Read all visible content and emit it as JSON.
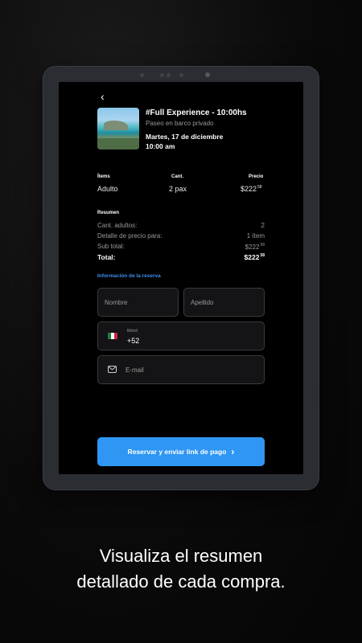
{
  "booking": {
    "title": "#Full Experience - 10:00hs",
    "subtitle": "Paseo en barco privado",
    "date": "Martes, 17 de diciembre",
    "time": "10:00 am"
  },
  "table": {
    "headers": {
      "items": "Ítems",
      "qty": "Cant.",
      "price": "Precio"
    },
    "row": {
      "item": "Adulto",
      "qty": "2 pax",
      "price_main": "$222",
      "price_cents": "58"
    }
  },
  "summary": {
    "title": "Resumen",
    "rows": [
      {
        "label": "Cant. adultos:",
        "value": "2"
      },
      {
        "label": "Detalle de precio para:",
        "value": "1 ítem"
      },
      {
        "label": "Sub total:",
        "value": "$222",
        "cents": "58"
      }
    ],
    "total": {
      "label": "Total:",
      "value": "$222",
      "cents": "58"
    }
  },
  "form": {
    "section_title": "Información de la reserva",
    "name_placeholder": "Nombre",
    "lastname_placeholder": "Apellido",
    "phone_label": "Móvil",
    "phone_prefix": "+52",
    "email_placeholder": "E-mail"
  },
  "actions": {
    "submit_label": "Reservar y enviar link de pago",
    "submit_icon": "chevron-right-icon"
  },
  "nav": {
    "back_icon": "chevron-left-icon"
  },
  "caption": {
    "line1": "Visualiza el resumen",
    "line2": "detallado de cada compra."
  },
  "colors": {
    "accent": "#2f96f3",
    "link": "#3d8ef0",
    "screen_bg": "#000000"
  }
}
